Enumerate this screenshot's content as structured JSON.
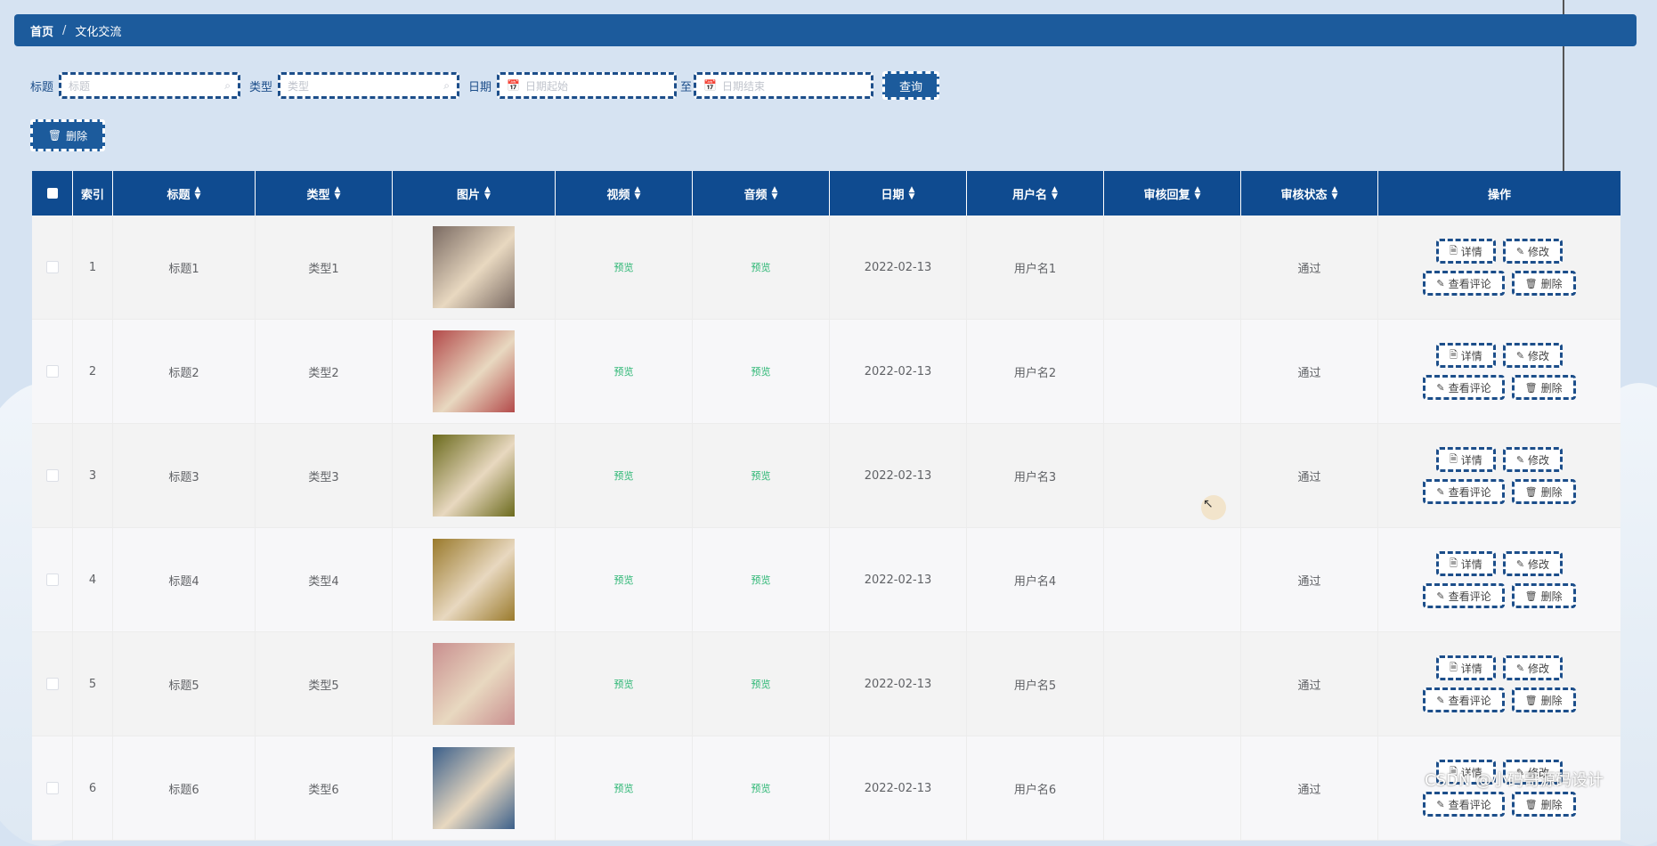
{
  "breadcrumb": {
    "home": "首页",
    "separator": "/",
    "current": "文化交流"
  },
  "search": {
    "title_label": "标题",
    "title_placeholder": "标题",
    "type_label": "类型",
    "type_placeholder": "类型",
    "date_label": "日期",
    "date_start_placeholder": "日期起始",
    "date_to": "至",
    "date_end_placeholder": "日期结束",
    "query_button": "查询"
  },
  "toolbar": {
    "delete_button": "删除"
  },
  "table": {
    "headers": [
      "索引",
      "标题",
      "类型",
      "图片",
      "视频",
      "音频",
      "日期",
      "用户名",
      "审核回复",
      "审核状态",
      "操作"
    ],
    "rows": [
      {
        "index": "1",
        "title": "标题1",
        "type": "类型1",
        "video": "预览",
        "audio": "预览",
        "date": "2022-02-13",
        "user": "用户名1",
        "reply": "",
        "status": "通过",
        "img_color": "#7a6a62"
      },
      {
        "index": "2",
        "title": "标题2",
        "type": "类型2",
        "video": "预览",
        "audio": "预览",
        "date": "2022-02-13",
        "user": "用户名2",
        "reply": "",
        "status": "通过",
        "img_color": "#b34a4a"
      },
      {
        "index": "3",
        "title": "标题3",
        "type": "类型3",
        "video": "预览",
        "audio": "预览",
        "date": "2022-02-13",
        "user": "用户名3",
        "reply": "",
        "status": "通过",
        "img_color": "#6b6a1c"
      },
      {
        "index": "4",
        "title": "标题4",
        "type": "类型4",
        "video": "预览",
        "audio": "预览",
        "date": "2022-02-13",
        "user": "用户名4",
        "reply": "",
        "status": "通过",
        "img_color": "#9a7a2c"
      },
      {
        "index": "5",
        "title": "标题5",
        "type": "类型5",
        "video": "预览",
        "audio": "预览",
        "date": "2022-02-13",
        "user": "用户名5",
        "reply": "",
        "status": "通过",
        "img_color": "#c98f8f"
      },
      {
        "index": "6",
        "title": "标题6",
        "type": "类型6",
        "video": "预览",
        "audio": "预览",
        "date": "2022-02-13",
        "user": "用户名6",
        "reply": "",
        "status": "通过",
        "img_color": "#3b5f8a"
      }
    ],
    "actions": {
      "detail": "详情",
      "edit": "修改",
      "comments": "查看评论",
      "delete": "删除"
    }
  },
  "watermark": "CSDN @小码哥源码设计",
  "colors": {
    "primary": "#1c5b9c",
    "header": "#0f4b90",
    "preview": "#2bb673",
    "background": "#d6e3f2"
  }
}
